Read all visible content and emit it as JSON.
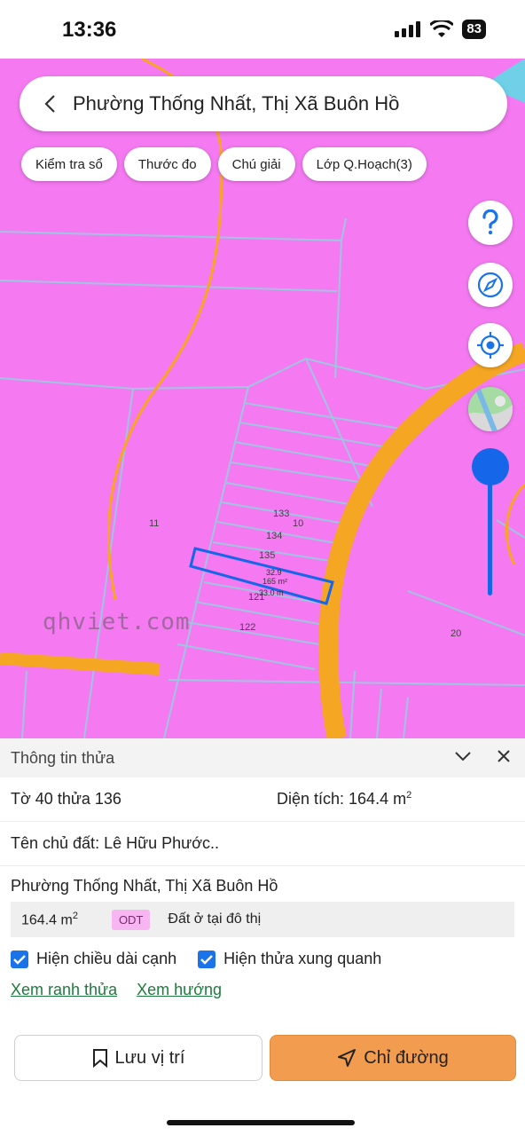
{
  "status": {
    "time": "13:36",
    "battery": "83"
  },
  "search": {
    "title": "Phường Thống Nhất, Thị Xã Buôn Hồ"
  },
  "chips": [
    "Kiểm tra sổ",
    "Thước đo",
    "Chú giải",
    "Lớp Q.Hoạch(3)"
  ],
  "map": {
    "watermark": "qhviet.com",
    "plots": {
      "p11": "11",
      "p133": "133",
      "p10": "10",
      "p134": "134",
      "p135": "135",
      "p121": "121",
      "p122": "122",
      "p20": "20"
    },
    "dims": {
      "top": "32.9",
      "area": "165 m²",
      "bottom": "33.0 m"
    },
    "colors": {
      "land": "#f57af2",
      "road": "#f5a623",
      "parcel": "#9fc4e0",
      "selected": "#1566e8"
    }
  },
  "panel": {
    "title": "Thông tin thửa",
    "sheet_plot": "Tờ 40 thửa 136",
    "area_label": "Diện tích: 164.4 m",
    "owner": "Tên chủ đất: Lê Hữu Phước..",
    "address": "Phường Thống Nhất, Thị Xã Buôn Hồ",
    "land_area": "164.4 m",
    "land_code": "ODT",
    "land_type": "Đất ở tại đô thị",
    "check_edges": "Hiện chiều dài cạnh",
    "check_neighbors": "Hiện thửa xung quanh",
    "link_boundary": "Xem ranh thửa",
    "link_direction": "Xem hướng",
    "save_label": "Lưu vị trí",
    "directions_label": "Chỉ đường"
  }
}
